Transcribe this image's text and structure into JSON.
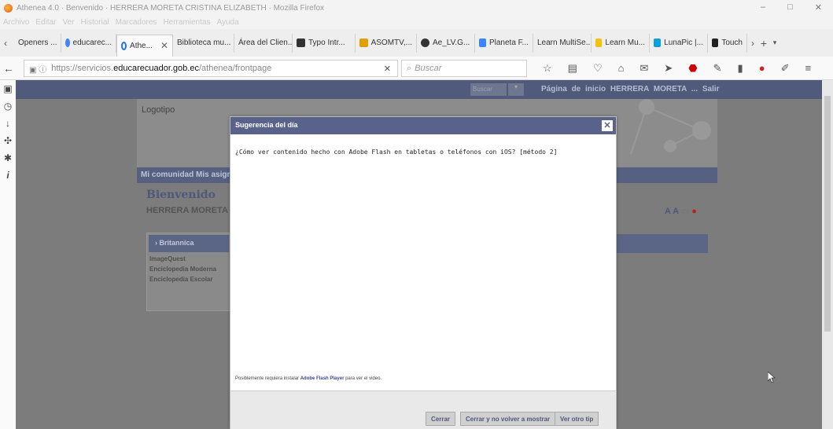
{
  "window": {
    "title": "Athenea 4.0 · Benvenido · HERRERA MORETA CRISTINA ELIZABETH · Mozilla Firefox",
    "controls": [
      "–",
      "□",
      "✕"
    ]
  },
  "menu": [
    "Archivo",
    "Editar",
    "Ver",
    "Historial",
    "Marcadores",
    "Herramientas",
    "Ayuda"
  ],
  "tabs": [
    {
      "label": "Openers ...",
      "color": "#3a6ea5"
    },
    {
      "label": "educarec...",
      "color": "#4285f4"
    },
    {
      "label": "Athe...",
      "color": "#1a73e8",
      "active": true
    },
    {
      "label": "Biblioteca mu...",
      "color": "#ffffff"
    },
    {
      "label": "Área del Clien...",
      "color": "#ffffff"
    },
    {
      "label": "Typo Intr...",
      "color": "#333333"
    },
    {
      "label": "ASOMTV,...",
      "color": "#e0a000"
    },
    {
      "label": "Ae_LV.G...",
      "color": "#333333"
    },
    {
      "label": "Planeta F...",
      "color": "#3a86ff"
    },
    {
      "label": "Learn MultiSe...",
      "color": "#ffffff"
    },
    {
      "label": "Learn Mu...",
      "color": "#f4c20d"
    },
    {
      "label": "LunaPic |...",
      "color": "#0aa0d8"
    },
    {
      "label": "Touch",
      "color": "#222222"
    }
  ],
  "nav": {
    "url_prefix": "https://servicios.",
    "url_domain": "educarecuador.gob.ec",
    "url_path": "/athenea/frontpage",
    "search_placeholder": "Buscar"
  },
  "site": {
    "search_label": "Buscar",
    "top_links": "Página de inicio  HERRERA MORETA ...  Salir",
    "logo_text": "Logotipo",
    "nav_text": "Mi comunidad  Mis asigna",
    "welcome": "Bienvenido",
    "username": "HERRERA MORETA CI",
    "font_tools": "A A",
    "resources_head": "› Britannica",
    "resources": [
      "ImageQuest",
      "Enciclopedia Moderna",
      "Enciclopedia Escolar"
    ]
  },
  "dialog": {
    "title": "Sugerencia del día",
    "tip": "¿Cómo ver contenido hecho con Adobe Flash en tabletas o teléfonos con iOS? [método 2]",
    "note_pre": "Posiblemente requiera instalar ",
    "note_link": "Adobe Flash Player",
    "note_post": " para ver el video.",
    "buttons": [
      "Cerrar",
      "Cerrar y no volver a mostrar",
      "Ver otro tip"
    ]
  }
}
